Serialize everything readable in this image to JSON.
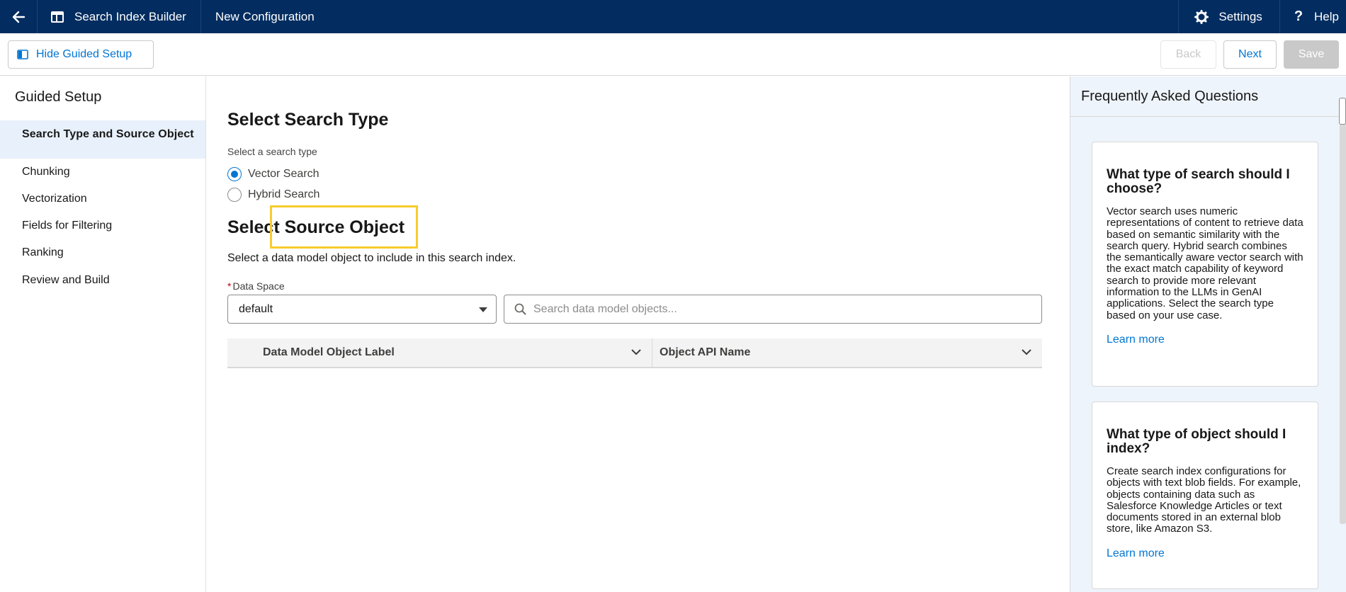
{
  "topbar": {
    "app_title": "Search Index Builder",
    "config_title": "New Configuration",
    "settings_label": "Settings",
    "help_label": "Help"
  },
  "toolbar": {
    "hide_label": "Hide Guided Setup",
    "back_label": "Back",
    "next_label": "Next",
    "save_label": "Save"
  },
  "sidebar": {
    "title": "Guided Setup",
    "items": [
      {
        "label": "Search Type and Source Object"
      },
      {
        "label": "Chunking"
      },
      {
        "label": "Vectorization"
      },
      {
        "label": "Fields for Filtering"
      },
      {
        "label": "Ranking"
      },
      {
        "label": "Review and Build"
      }
    ]
  },
  "main": {
    "search_type_heading": "Select Search Type",
    "search_type_label": "Select a search type",
    "radio_options": [
      {
        "label": "Vector Search",
        "checked": true
      },
      {
        "label": "Hybrid Search",
        "checked": false
      }
    ],
    "source_heading": "Select Source Object",
    "source_description": "Select a data model object to include in this search index.",
    "data_space_required": "*",
    "data_space_label": "Data Space",
    "data_space_value": "default",
    "search_placeholder": "Search data model objects...",
    "columns": [
      "Data Model Object Label",
      "Object API Name"
    ]
  },
  "faq": {
    "title": "Frequently Asked Questions",
    "cards": [
      {
        "question": "What type of search should I choose?",
        "answer": "Vector search uses numeric representations of content to retrieve data based on semantic similarity with the search query. Hybrid search combines the semantically aware vector search with the exact match capability of keyword search to provide more relevant information to the LLMs in GenAI applications. Select the search type based on your use case.",
        "link": "Learn more"
      },
      {
        "question": "What type of object should I index?",
        "answer": "Create search index configurations for objects with text blob fields. For example, objects containing data such as Salesforce Knowledge Articles or text documents stored in an external blob store, like Amazon S3.",
        "link": "Learn more"
      }
    ]
  },
  "colors": {
    "nav_bg": "#032d60",
    "accent": "#0176d3",
    "highlight": "#f7cc2e",
    "active_item_bg": "#e8f1fb",
    "faq_bg": "#eef4fb"
  }
}
